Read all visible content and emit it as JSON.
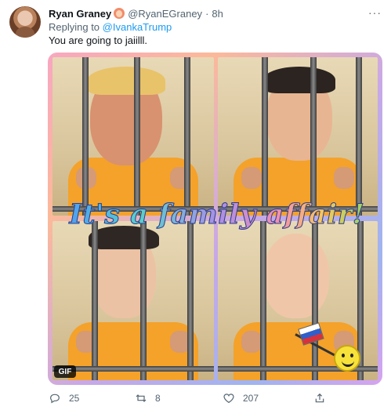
{
  "tweet": {
    "author_name": "Ryan Graney",
    "author_handle": "@RyanEGraney",
    "separator": "·",
    "time": "8h",
    "replying_prefix": "Replying to",
    "replying_to": "@IvankaTrump",
    "text": "You are going to jaiilll.",
    "more_label": "···"
  },
  "media": {
    "banner_text": "It's a family affair!",
    "gif_badge": "GIF"
  },
  "actions": {
    "reply_count": "25",
    "retweet_count": "8",
    "like_count": "207",
    "share_icon": "share-icon"
  },
  "colors": {
    "link": "#1d9bf0",
    "secondary_text": "#536471",
    "jumpsuit": "#f4a22a"
  }
}
